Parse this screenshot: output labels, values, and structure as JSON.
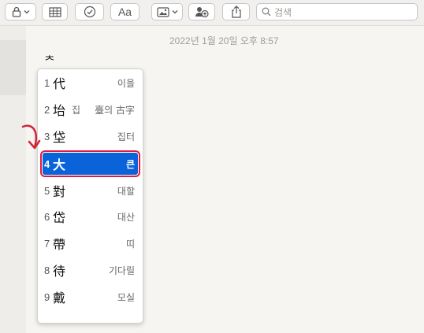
{
  "toolbar": {
    "search_placeholder": "검색",
    "format_label": "Aa"
  },
  "note": {
    "date": "2022년 1월 20일 오후 8:57",
    "composing_text": "ᄎ"
  },
  "candidates": [
    {
      "num": "1",
      "hanja": "代",
      "extra": "",
      "reading": "이을"
    },
    {
      "num": "2",
      "hanja": "坮",
      "extra": "집",
      "reading": "臺의 古字"
    },
    {
      "num": "3",
      "hanja": "垈",
      "extra": "",
      "reading": "집터"
    },
    {
      "num": "4",
      "hanja": "大",
      "extra": "",
      "reading": "큰"
    },
    {
      "num": "5",
      "hanja": "對",
      "extra": "",
      "reading": "대할"
    },
    {
      "num": "6",
      "hanja": "岱",
      "extra": "",
      "reading": "대산"
    },
    {
      "num": "7",
      "hanja": "帶",
      "extra": "",
      "reading": "띠"
    },
    {
      "num": "8",
      "hanja": "待",
      "extra": "",
      "reading": "기다릴"
    },
    {
      "num": "9",
      "hanja": "戴",
      "extra": "",
      "reading": "모실"
    }
  ],
  "selected_index": 3,
  "colors": {
    "selection": "#0a63d8",
    "highlight_outline": "#e01a3f",
    "arrow": "#d3243a"
  }
}
